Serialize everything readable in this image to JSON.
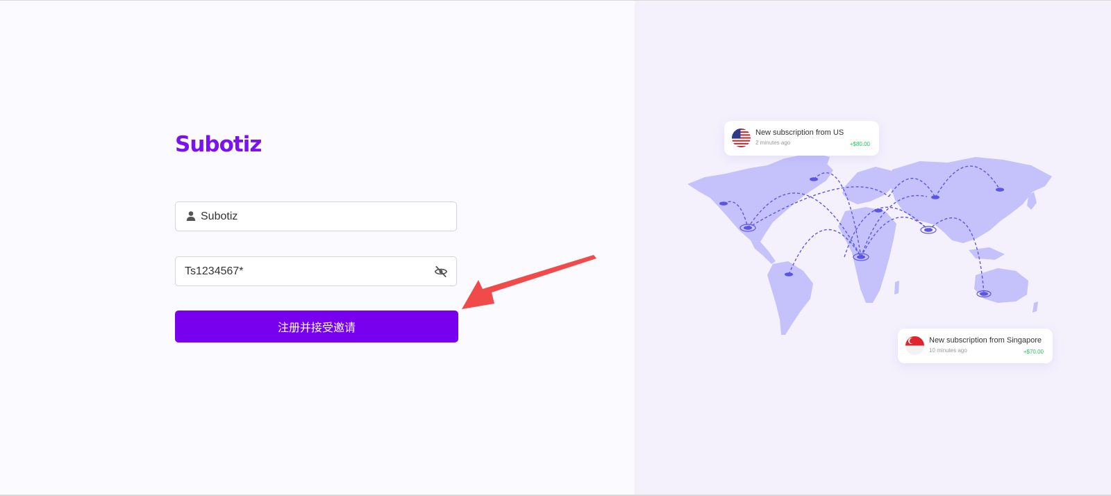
{
  "app": {
    "logo": "Subotiz"
  },
  "form": {
    "username": {
      "value": "Subotiz",
      "icon": "user-icon"
    },
    "password": {
      "value": "Ts1234567*",
      "icon": "eye-off-icon"
    },
    "submit_label": "注册并接受邀请"
  },
  "notifications": [
    {
      "title": "New subscription from US",
      "time": "2 minutes ago",
      "amount": "+$80.00",
      "flag": "us-flag"
    },
    {
      "title": "New subscription from Singapore",
      "time": "10 minutes ago",
      "amount": "+$70.00",
      "flag": "singapore-flag"
    }
  ],
  "colors": {
    "brand": "#7a12ef",
    "button": "#7900ef",
    "map": "#c5c2fb",
    "route": "#5b55e6",
    "amount": "#22c55e",
    "annotation_arrow": "#f04a4a"
  }
}
